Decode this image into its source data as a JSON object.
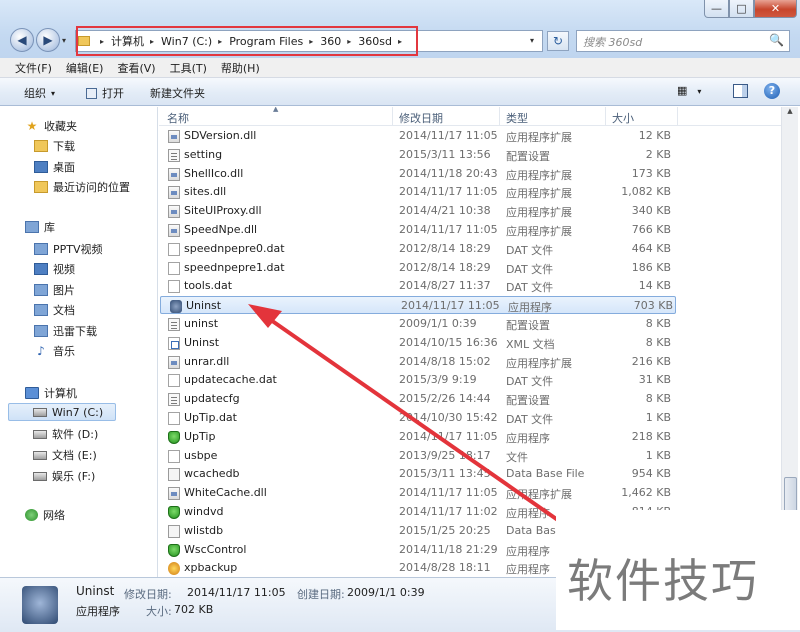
{
  "window": {
    "minimize_glyph": "—",
    "maximize_glyph": "□",
    "close_glyph": "✕"
  },
  "nav": {
    "back_glyph": "◀",
    "forward_glyph": "▶",
    "dropdown_glyph": "▾",
    "refresh_glyph": "↻"
  },
  "address": {
    "crumbs": [
      "计算机",
      "Win7 (C:)",
      "Program Files",
      "360",
      "360sd"
    ],
    "sep_glyph": "▸",
    "dropdown_glyph": "▾",
    "highlight_color": "#e2373f"
  },
  "search": {
    "placeholder": "搜索 360sd",
    "icon_glyph": "🔍"
  },
  "menubar": {
    "items": [
      "文件(F)",
      "编辑(E)",
      "查看(V)",
      "工具(T)",
      "帮助(H)"
    ]
  },
  "toolbar": {
    "organize": "组织",
    "open": "打开",
    "new_folder": "新建文件夹",
    "view_glyph": "▦",
    "help_glyph": "?"
  },
  "navpane": {
    "favorites": "收藏夹",
    "downloads": "下载",
    "desktop": "桌面",
    "recent": "最近访问的位置",
    "libraries": "库",
    "pptv": "PPTV视频",
    "videos": "视频",
    "pictures": "图片",
    "documents": "文档",
    "thunder": "迅雷下载",
    "music": "音乐",
    "computer": "计算机",
    "drive_c": "Win7 (C:)",
    "drive_d": "软件 (D:)",
    "drive_e": "文档 (E:)",
    "drive_f": "娱乐 (F:)",
    "network": "网络",
    "star_glyph": "★",
    "music_glyph": "♪"
  },
  "columns": {
    "name": "名称",
    "date": "修改日期",
    "type": "类型",
    "size": "大小",
    "sort_glyph": "▲"
  },
  "files": [
    {
      "name": "SDVersion.dll",
      "date": "2014/11/17 11:05",
      "type": "应用程序扩展",
      "size": "12 KB",
      "icon": "dll"
    },
    {
      "name": "setting",
      "date": "2015/3/11 13:56",
      "type": "配置设置",
      "size": "2 KB",
      "icon": "cfg"
    },
    {
      "name": "ShellIco.dll",
      "date": "2014/11/18 20:43",
      "type": "应用程序扩展",
      "size": "173 KB",
      "icon": "dll"
    },
    {
      "name": "sites.dll",
      "date": "2014/11/17 11:05",
      "type": "应用程序扩展",
      "size": "1,082 KB",
      "icon": "dll"
    },
    {
      "name": "SiteUIProxy.dll",
      "date": "2014/4/21 10:38",
      "type": "应用程序扩展",
      "size": "340 KB",
      "icon": "dll"
    },
    {
      "name": "SpeedNpe.dll",
      "date": "2014/11/17 11:05",
      "type": "应用程序扩展",
      "size": "766 KB",
      "icon": "dll"
    },
    {
      "name": "speednpepre0.dat",
      "date": "2012/8/14 18:29",
      "type": "DAT 文件",
      "size": "464 KB",
      "icon": "file"
    },
    {
      "name": "speednpepre1.dat",
      "date": "2012/8/14 18:29",
      "type": "DAT 文件",
      "size": "186 KB",
      "icon": "file"
    },
    {
      "name": "tools.dat",
      "date": "2014/8/27 11:37",
      "type": "DAT 文件",
      "size": "14 KB",
      "icon": "file"
    },
    {
      "name": "Uninst",
      "date": "2014/11/17 11:05",
      "type": "应用程序",
      "size": "703 KB",
      "icon": "uninst",
      "selected": true
    },
    {
      "name": "uninst",
      "date": "2009/1/1 0:39",
      "type": "配置设置",
      "size": "8 KB",
      "icon": "cfg"
    },
    {
      "name": "Uninst",
      "date": "2014/10/15 16:36",
      "type": "XML 文档",
      "size": "8 KB",
      "icon": "xml"
    },
    {
      "name": "unrar.dll",
      "date": "2014/8/18 15:02",
      "type": "应用程序扩展",
      "size": "216 KB",
      "icon": "dll"
    },
    {
      "name": "updatecache.dat",
      "date": "2015/3/9 9:19",
      "type": "DAT 文件",
      "size": "31 KB",
      "icon": "file"
    },
    {
      "name": "updatecfg",
      "date": "2015/2/26 14:44",
      "type": "配置设置",
      "size": "8 KB",
      "icon": "cfg"
    },
    {
      "name": "UpTip.dat",
      "date": "2014/10/30 15:42",
      "type": "DAT 文件",
      "size": "1 KB",
      "icon": "file"
    },
    {
      "name": "UpTip",
      "date": "2014/11/17 11:05",
      "type": "应用程序",
      "size": "218 KB",
      "icon": "shield"
    },
    {
      "name": "usbpe",
      "date": "2013/9/25 18:17",
      "type": "文件",
      "size": "1 KB",
      "icon": "file"
    },
    {
      "name": "wcachedb",
      "date": "2015/3/11 13:45",
      "type": "Data Base File",
      "size": "954 KB",
      "icon": "db"
    },
    {
      "name": "WhiteCache.dll",
      "date": "2014/11/17 11:05",
      "type": "应用程序扩展",
      "size": "1,462 KB",
      "icon": "dll"
    },
    {
      "name": "windvd",
      "date": "2014/11/17 11:02",
      "type": "应用程序",
      "size": "814 KB",
      "icon": "shield"
    },
    {
      "name": "wlistdb",
      "date": "2015/1/25 20:25",
      "type": "Data Base",
      "size": "",
      "icon": "db"
    },
    {
      "name": "WscControl",
      "date": "2014/11/18 21:29",
      "type": "应用程序",
      "size": "",
      "icon": "shield"
    },
    {
      "name": "xpbackup",
      "date": "2014/8/28 18:11",
      "type": "应用程序",
      "size": "",
      "icon": "xp"
    }
  ],
  "details": {
    "name": "Uninst",
    "type": "应用程序",
    "modified_label": "修改日期:",
    "modified": "2014/11/17 11:05",
    "created_label": "创建日期:",
    "created": "2009/1/1 0:39",
    "size_label": "大小:",
    "size": "702 KB"
  },
  "watermark": {
    "text": "软件技巧"
  },
  "annotation_arrow_color": "#e3343b"
}
